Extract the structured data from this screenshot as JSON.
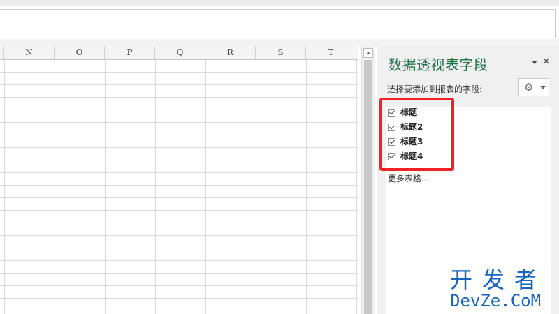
{
  "sheet": {
    "columns": [
      "N",
      "O",
      "P",
      "Q",
      "R",
      "S",
      "T"
    ]
  },
  "pivot_pane": {
    "title": "数据透视表字段",
    "close_glyph": "×",
    "subtitle": "选择要添加到报表的字段:",
    "settings_icon": "gear-icon",
    "fields": [
      {
        "label": "标题",
        "checked": true
      },
      {
        "label": "标题2",
        "checked": true
      },
      {
        "label": "标题3",
        "checked": true
      },
      {
        "label": "标题4",
        "checked": true
      }
    ],
    "more_tables": "更多表格..."
  },
  "highlight_color": "#ee2222",
  "accent_color": "#1e7145",
  "watermark": {
    "cn": "开发者",
    "en": "DevZe.CoM"
  }
}
